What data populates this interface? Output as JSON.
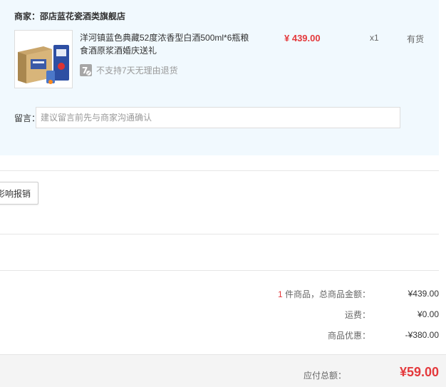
{
  "shop": {
    "name": "商家：邵店蓝花瓷酒类旗舰店"
  },
  "product": {
    "title": "洋河镇蓝色典藏52度浓香型白酒500ml*6瓶粮食酒原浆酒婚庆送礼",
    "price": "¥ 439.00",
    "qty": "x1",
    "stock": "有货",
    "return_policy": "不支持7天无理由退货",
    "return_icon": "7-day-return-icon"
  },
  "message": {
    "label": "留言：",
    "placeholder": "建议留言前先与商家沟通确认",
    "value": ""
  },
  "invoice": {
    "button_label": "影响报销"
  },
  "summary": {
    "count": "1",
    "count_suffix": " 件商品，总商品金额：",
    "goods_amount": "¥439.00",
    "shipping_label": "运费：",
    "shipping_amount": "¥0.00",
    "discount_label": "商品优惠：",
    "discount_amount": "-¥380.00"
  },
  "total": {
    "label": "应付总额：",
    "amount": "¥59.00"
  },
  "colors": {
    "accent_red": "#e4393c",
    "shop_block_bg": "#f1f9fe",
    "total_bar_bg": "#f4f4f4"
  }
}
